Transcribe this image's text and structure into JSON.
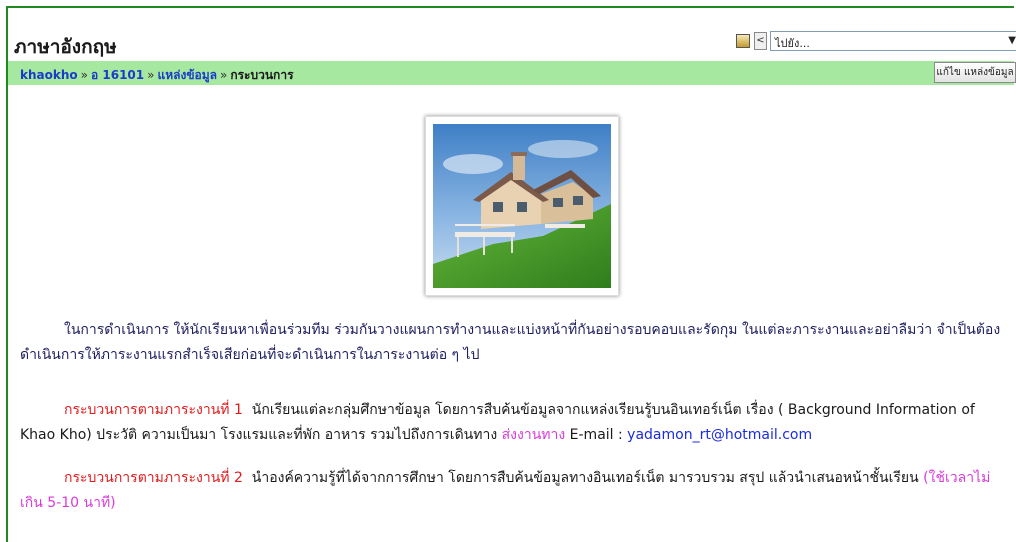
{
  "header": {
    "course_title": "ภาษาอังกฤษ",
    "jump_select": "ไปยัง...",
    "prev_label": "<"
  },
  "breadcrumb": {
    "items": [
      "khaokho",
      "อ 16101",
      "แหล่งข้อมูล",
      "กระบวนการ"
    ],
    "separator": "»"
  },
  "edit_button": "แก้ไข แหล่งข้อมูล",
  "paragraph1": "ในการดำเนินการ ให้นักเรียนหาเพื่อนร่วมทีม ร่วมกันวางแผนการทำงานและแบ่งหน้าที่กันอย่างรอบคอบและรัดกุม ในแต่ละภาระงานและอย่าลืมว่า จำเป็นต้องดำเนินการให้ภาระงานแรกสำเร็จเสียก่อนที่จะดำเนินการในภาระงานต่อ ๆ ไป",
  "task1": {
    "label": "กระบวนการตามภาระงานที่ 1",
    "body": "นักเรียนแต่ละกลุ่มศึกษาข้อมูล โดยการสืบค้นข้อมูลจากแหล่งเรียนรู้บนอินเทอร์เน็ต เรื่อง ( Background Information of Khao Kho) ประวัติ ความเป็นมา โรงแรมและที่พัก อาหาร รวมไปถึงการเดินทาง",
    "send_label": "ส่งงานทาง",
    "email_prefix": "E-mail :",
    "email": "yadamon_rt@hotmail.com"
  },
  "task2": {
    "label": "กระบวนการตามภาระงานที่ 2",
    "body": "นำองค์ความรู้ที่ได้จากการศึกษา โดยการสืบค้นข้อมูลทางอินเทอร์เน็ต มารวบรวม สรุป แล้วนำเสนอหน้าชั้นเรียน",
    "time_note": "(ใช้เวลาไม่เกิน 5-10 นาที)"
  },
  "colors": {
    "navbar": "#a6e8a0",
    "border": "#1f8a1f",
    "task_label": "#e11b1b",
    "highlight": "#d93bd9",
    "link": "#1a2ce0"
  }
}
